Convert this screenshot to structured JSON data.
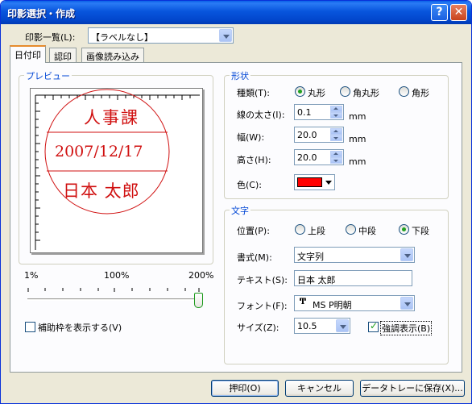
{
  "window": {
    "title": "印影選択・作成",
    "help_label": "?",
    "close_label": "✕"
  },
  "seal_list": {
    "label": "印影一覧(L):",
    "value": "【ラベルなし】"
  },
  "tabs": [
    "日付印",
    "認印",
    "画像読み込み"
  ],
  "preview": {
    "group_title": "プレビュー",
    "seal_top": "人事課",
    "seal_middle": "2007/12/17",
    "seal_bottom": "日本 太郎",
    "seal_color": "#d01010",
    "zoom_labels": [
      "1%",
      "100%",
      "200%"
    ],
    "zoom_value_percent": 200,
    "show_guides_label": "補助枠を表示する(V)",
    "show_guides_checked": false
  },
  "shape": {
    "group_title": "形状",
    "type_label": "種類(T):",
    "type_options": [
      "丸形",
      "角丸形",
      "角形"
    ],
    "type_selected": 0,
    "line_width_label": "線の太さ(I):",
    "line_width_value": "0.1",
    "width_label": "幅(W):",
    "width_value": "20.0",
    "height_label": "高さ(H):",
    "height_value": "20.0",
    "unit": "mm",
    "color_label": "色(C):",
    "color_value": "#ff0000"
  },
  "text": {
    "group_title": "文字",
    "position_label": "位置(P):",
    "position_options": [
      "上段",
      "中段",
      "下段"
    ],
    "position_selected": 2,
    "format_label": "書式(M):",
    "format_value": "文字列",
    "text_label": "テキスト(S):",
    "text_value": "日本 太郎",
    "font_label": "フォント(F):",
    "font_value": "MS P明朝",
    "size_label": "サイズ(Z):",
    "size_value": "10.5",
    "emphasis_label": "強調表示(B)",
    "emphasis_checked": true
  },
  "buttons": {
    "stamp": "押印(O)",
    "cancel": "キャンセル",
    "save_tray": "データトレーに保存(X)..."
  }
}
